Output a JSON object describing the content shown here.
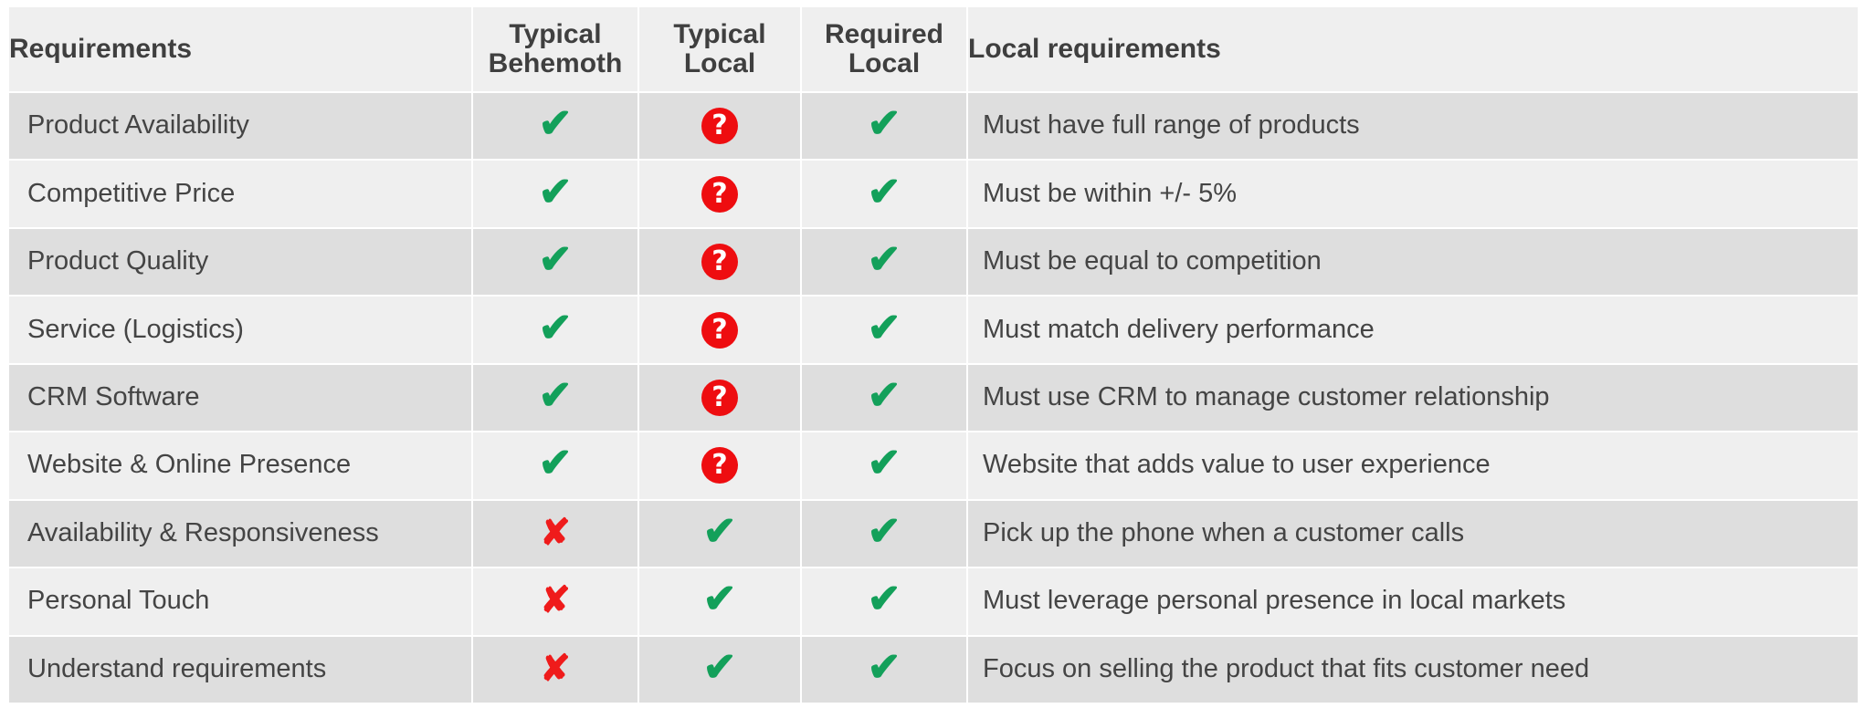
{
  "table": {
    "columns": [
      {
        "key": "requirement",
        "label_lines": [
          "Requirements"
        ],
        "align": "left"
      },
      {
        "key": "typical_behemoth",
        "label_lines": [
          "Typical",
          "Behemoth"
        ],
        "align": "center"
      },
      {
        "key": "typical_local",
        "label_lines": [
          "Typical",
          "Local"
        ],
        "align": "center"
      },
      {
        "key": "required_local",
        "label_lines": [
          "Required",
          "Local"
        ],
        "align": "center"
      },
      {
        "key": "local_requirements",
        "label_lines": [
          "Local requirements"
        ],
        "align": "left"
      }
    ],
    "header": {
      "col1": "Requirements",
      "col2_line1": "Typical",
      "col2_line2": "Behemoth",
      "col3_line1": "Typical",
      "col3_line2": "Local",
      "col4_line1": "Required",
      "col4_line2": "Local",
      "col5": "Local requirements"
    },
    "icons": {
      "check": {
        "name": "check-icon",
        "glyph": "✔",
        "color": "#13a05a",
        "meaning": "yes"
      },
      "cross": {
        "name": "cross-icon",
        "glyph": "✘",
        "color": "#ef1b1b",
        "meaning": "no"
      },
      "question": {
        "name": "question-circle-icon",
        "glyph": "?",
        "color": "#ffffff",
        "background": "#ee0d10",
        "meaning": "unknown"
      }
    },
    "colors": {
      "row_odd_bg": "#dedede",
      "row_even_bg": "#efefef",
      "header_bg": "#efefef",
      "text": "#444444",
      "header_text": "#3f3f3f",
      "grid": "#ffffff",
      "green": "#13a05a",
      "red": "#ef1b1b",
      "red_circle": "#ee0d10"
    },
    "rows": [
      {
        "requirement": "Product Availability",
        "typical_behemoth": "check",
        "typical_local": "question",
        "required_local": "check",
        "local_requirements": "Must have full range of products"
      },
      {
        "requirement": "Competitive Price",
        "typical_behemoth": "check",
        "typical_local": "question",
        "required_local": "check",
        "local_requirements": "Must be within +/- 5%"
      },
      {
        "requirement": "Product Quality",
        "typical_behemoth": "check",
        "typical_local": "question",
        "required_local": "check",
        "local_requirements": "Must be equal to competition"
      },
      {
        "requirement": "Service (Logistics)",
        "typical_behemoth": "check",
        "typical_local": "question",
        "required_local": "check",
        "local_requirements": "Must match delivery performance"
      },
      {
        "requirement": "CRM Software",
        "typical_behemoth": "check",
        "typical_local": "question",
        "required_local": "check",
        "local_requirements": "Must use CRM to manage customer relationship"
      },
      {
        "requirement": "Website & Online Presence",
        "typical_behemoth": "check",
        "typical_local": "question",
        "required_local": "check",
        "local_requirements": "Website that adds value to user experience"
      },
      {
        "requirement": "Availability & Responsiveness",
        "typical_behemoth": "cross",
        "typical_local": "check",
        "required_local": "check",
        "local_requirements": "Pick up the phone when a customer calls"
      },
      {
        "requirement": "Personal Touch",
        "typical_behemoth": "cross",
        "typical_local": "check",
        "required_local": "check",
        "local_requirements": "Must leverage personal presence in local markets"
      },
      {
        "requirement": "Understand requirements",
        "typical_behemoth": "cross",
        "typical_local": "check",
        "required_local": "check",
        "local_requirements": "Focus on selling the product that fits customer need"
      }
    ]
  }
}
